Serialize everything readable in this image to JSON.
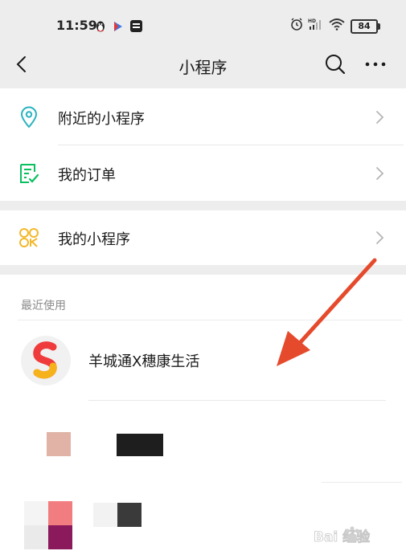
{
  "status_bar": {
    "time": "11:59",
    "battery": "84",
    "hd_label": "HD"
  },
  "nav": {
    "title": "小程序"
  },
  "menu": {
    "items": [
      {
        "label": "附近的小程序",
        "icon": "location-pin-icon"
      },
      {
        "label": "我的订单",
        "icon": "order-list-icon"
      },
      {
        "label": "我的小程序",
        "icon": "my-miniprogram-icon"
      }
    ]
  },
  "recent": {
    "section_label": "最近使用",
    "items": [
      {
        "name": "羊城通X穗康生活",
        "icon": "s-logo-icon"
      }
    ]
  },
  "watermark": {
    "text": "Bai 经验"
  },
  "colors": {
    "bar_bg": "#ededed",
    "green": "#07c160",
    "teal": "#2ab3c0",
    "yellow": "#f3b82a",
    "arrow_red": "#e54a2c"
  }
}
